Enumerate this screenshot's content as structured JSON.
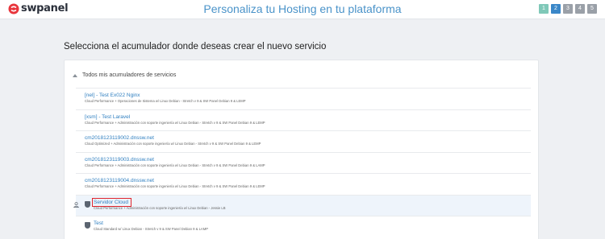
{
  "header": {
    "brand": "swpanel",
    "page_heading": "Personaliza tu Hosting en tu plataforma",
    "steps": [
      "1",
      "2",
      "3",
      "4",
      "5"
    ],
    "current_step": "2"
  },
  "main": {
    "section_title": "Selecciona el acumulador donde deseas crear el nuevo servicio",
    "group_label": "Todos mis acumuladores de servicios",
    "items": [
      {
        "name": "[nel] - Test Ex022 Nginx",
        "description": "Cloud Performance + Operaciones de Sistema w/ Linux Debian - Stretch v 9 & SW Panel Debian 9 & LEMP"
      },
      {
        "name": "[xsm] - Test Laravel",
        "description": "Cloud Performance + Administración con soporte ingeniería w/ Linux Debian - Stretch v 9 & SW Panel Debian 9 & LEMP"
      },
      {
        "name": "cm2018123119002.dnssw.net",
        "description": "Cloud Optimized + Administración con soporte ingeniería w/ Linux Debian - Stretch v 9 & SW Panel Debian 9 & LEMP"
      },
      {
        "name": "cm2018123119003.dnssw.net",
        "description": "Cloud Performance + Administración con soporte ingeniería w/ Linux Debian - Stretch v 9 & SW Panel Debian 9 & LAMP"
      },
      {
        "name": "cm2018123119004.dnssw.net",
        "description": "Cloud Performance + Administración con soporte ingeniería w/ Linux Debian - Stretch v 9 & SW Panel Debian 9 & LEMP"
      },
      {
        "name": "Servidor Cloud",
        "description": "Cloud Performance + Administración con soporte ingeniería w/ Linux Debian - Jessie LB"
      },
      {
        "name": "Test",
        "description": "Cloud Standard w/ Linux Debian - Stretch v 9 & SW Panel Debian 9 & LAMP"
      }
    ]
  },
  "colors": {
    "accent": "#3a87c8",
    "link": "#2f7fc0",
    "highlight": "#e0262e"
  }
}
